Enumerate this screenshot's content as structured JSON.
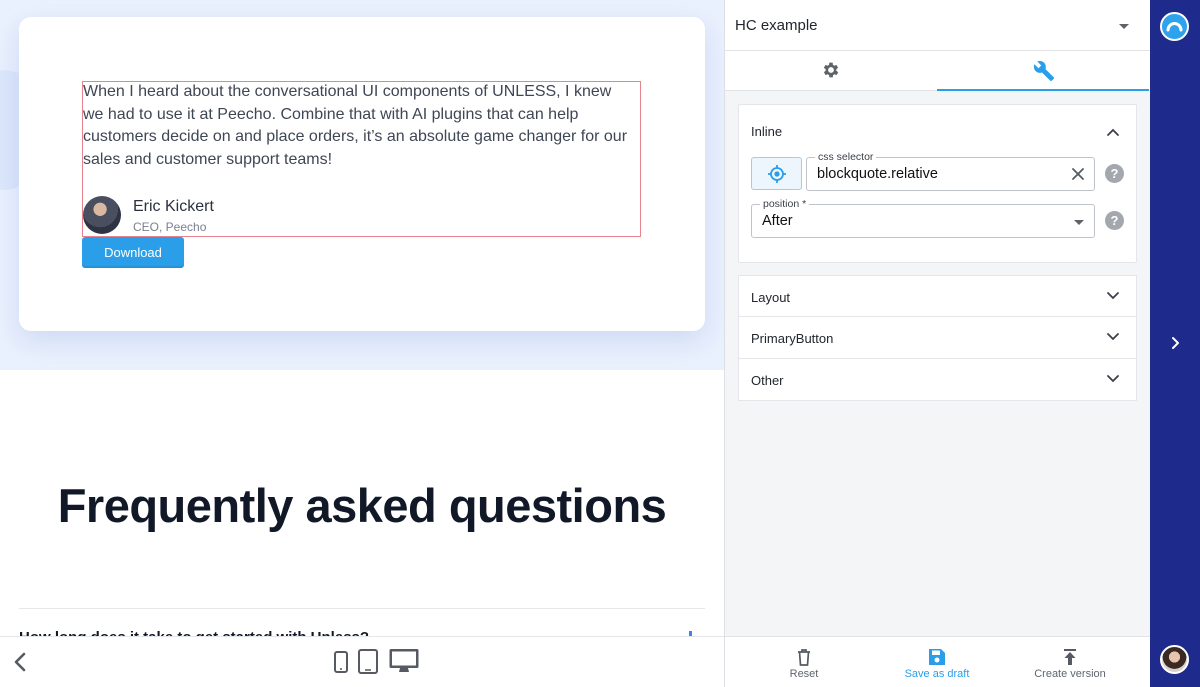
{
  "preview": {
    "testimonial": {
      "quote": "When I heard about the conversational UI components of UNLESS, I knew we had to use it at Peecho. Combine that with AI plugins that can help customers decide on and place orders, it’s an absolute game changer for our sales and customer support teams!",
      "author_name": "Eric Kickert",
      "author_role": "CEO, Peecho",
      "button_label": "Download"
    },
    "faq": {
      "title": "Frequently asked questions",
      "first_question_peek": "How long does it take to get started with Unless?"
    },
    "toolbar": {
      "back_icon": "chevron-left-icon",
      "devices": [
        "mobile-icon",
        "tablet-icon",
        "desktop-icon"
      ]
    }
  },
  "editor": {
    "title": "HC example",
    "tabs": [
      {
        "icon": "gear-icon"
      },
      {
        "icon": "wrench-icon",
        "active": true
      }
    ],
    "inline": {
      "label": "Inline",
      "css_selector_label": "css selector",
      "css_selector_value": "blockquote.relative",
      "position_label": "position *",
      "position_value": "After"
    },
    "sections": [
      {
        "label": "Layout"
      },
      {
        "label": "PrimaryButton"
      },
      {
        "label": "Other"
      }
    ],
    "footer": {
      "reset": "Reset",
      "save": "Save as draft",
      "version": "Create version"
    }
  },
  "colors": {
    "accent": "#2a9ee9",
    "rail": "#1e2a8c",
    "hero_bg": "#eaf1fe",
    "highlight": "#e8838e"
  }
}
